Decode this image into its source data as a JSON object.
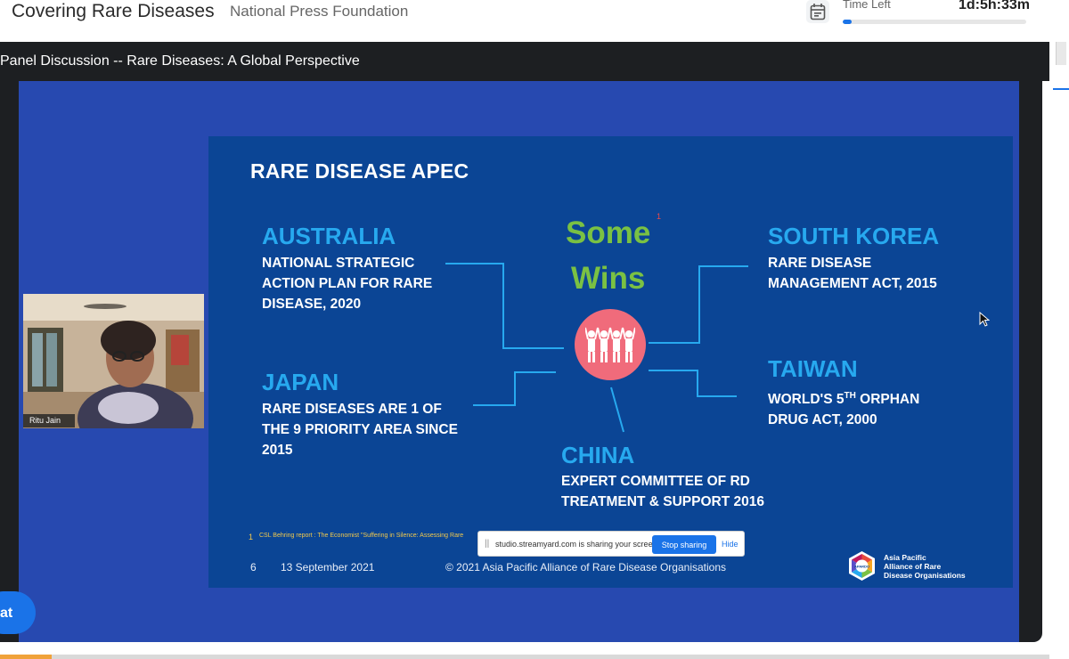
{
  "header": {
    "event_title": "Covering Rare Diseases",
    "organization": "National Press Foundation",
    "calendar_icon": "calendar-icon",
    "time_left_label": "Time Left",
    "time_left_value": "1d:5h:33m",
    "time_progress": 0.05
  },
  "session": {
    "title": "Panel Discussion -- Rare Diseases: A Global Perspective"
  },
  "webcam": {
    "speaker_name": "Ritu Jain"
  },
  "slide": {
    "title": "RARE DISEASE APEC",
    "center": {
      "line1": "Some",
      "line2": "Wins",
      "footnote_mark": "1",
      "icon": "people-group-icon"
    },
    "items": [
      {
        "country": "AUSTRALIA",
        "lines": [
          "NATIONAL STRATEGIC",
          "ACTION PLAN FOR RARE",
          "DISEASE, 2020"
        ]
      },
      {
        "country": "JAPAN",
        "lines": [
          "RARE DISEASES ARE 1 OF",
          "THE 9 PRIORITY AREA SINCE",
          "2015"
        ]
      },
      {
        "country": "SOUTH KOREA",
        "lines": [
          "RARE DISEASE",
          "MANAGEMENT ACT, 2015"
        ]
      },
      {
        "country": "TAIWAN",
        "lines": [
          "WORLD'S 5",
          "TH",
          " ORPHAN",
          "DRUG ACT, 2000"
        ]
      },
      {
        "country": "CHINA",
        "lines": [
          "EXPERT COMMITTEE OF RD",
          "TREATMENT & SUPPORT 2016"
        ]
      }
    ],
    "footnote_num": "1",
    "footnote_text": "CSL Behring report : The Economist \"Suffering in Silence: Assessing Rare",
    "page_num": "6",
    "date": "13 September 2021",
    "copyright": "© 2021 Asia Pacific Alliance of Rare Disease Organisations",
    "logo_lines": [
      "Asia Pacific",
      "Alliance of Rare",
      "Disease Organisations"
    ],
    "logo_mark": "APARDO",
    "colors": {
      "background": "#0b4595",
      "country": "#27a9ef",
      "wins": "#7ac143",
      "circle": "#f06b7b"
    }
  },
  "share_notice": {
    "grip": "||",
    "text": "studio.streamyard.com is sharing your screen.",
    "stop_label": "Stop sharing",
    "hide_label": "Hide"
  },
  "chat": {
    "label": "at"
  }
}
